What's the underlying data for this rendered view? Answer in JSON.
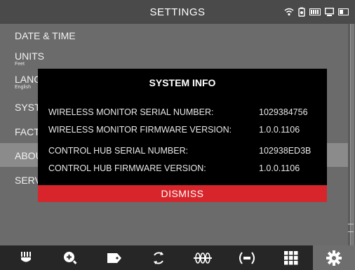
{
  "header": {
    "title": "SETTINGS"
  },
  "status_icons": [
    "wifi-icon",
    "battery-icon",
    "monitor-icon",
    "device-icon"
  ],
  "menu": {
    "items": [
      {
        "label": "DATE & TIME",
        "sub": ""
      },
      {
        "label": "UNITS",
        "sub": "Feet"
      },
      {
        "label": "LANGUAGE",
        "sub": "English"
      },
      {
        "label": "SYSTEM INFO",
        "sub": ""
      },
      {
        "label": "FACTORY RESET",
        "sub": ""
      },
      {
        "label": "ABOUT",
        "sub": ""
      },
      {
        "label": "SERVICE",
        "sub": ""
      }
    ],
    "selected_index": 5
  },
  "dialog": {
    "title": "SYSTEM INFO",
    "rows": [
      {
        "key": "WIRELESS MONITOR SERIAL NUMBER:",
        "value": "1029384756"
      },
      {
        "key": "WIRELESS MONITOR FIRMWARE VERSION:",
        "value": "1.0.0.1106"
      },
      {
        "key": "CONTROL HUB SERIAL NUMBER:",
        "value": "102938ED3B"
      },
      {
        "key": "CONTROL HUB FIRMWARE VERSION:",
        "value": "1.0.0.1106"
      }
    ],
    "dismiss_label": "DISMISS"
  },
  "toolbar": {
    "buttons": [
      "claw-icon",
      "zoom-in-icon",
      "tag-icon",
      "rotate-icon",
      "track-icon",
      "broadcast-icon",
      "grid-icon",
      "gear-icon"
    ],
    "active_index": 7
  },
  "colors": {
    "accent": "#d8252b",
    "background": "#6b6b6b",
    "dialog": "#000000",
    "toolbar": "#262626"
  }
}
